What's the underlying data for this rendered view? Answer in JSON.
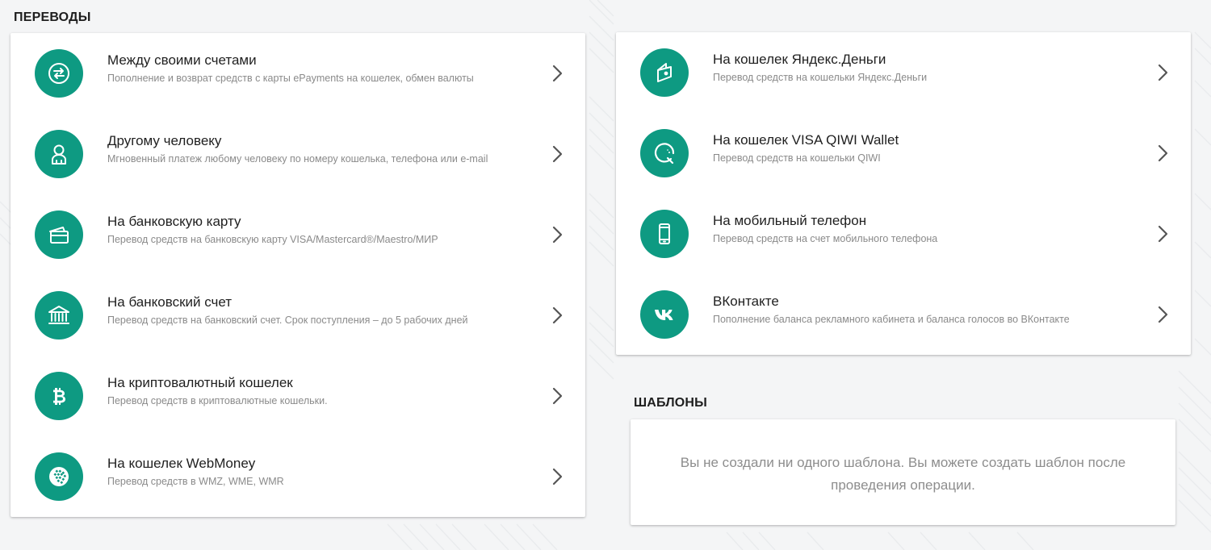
{
  "transfers": {
    "title": "ПЕРЕВОДЫ",
    "left_items": [
      {
        "title": "Между своими счетами",
        "desc": "Пополнение и возврат средств с карты ePayments на кошелек, обмен валюты",
        "icon": "exchange-arrows-icon"
      },
      {
        "title": "Другому человеку",
        "desc": "Мгновенный платеж любому человеку по номеру кошелька, телефона или e-mail",
        "icon": "person-icon"
      },
      {
        "title": "На банковскую карту",
        "desc": "Перевод средств на банковскую карту VISA/Mastercard®/Maestro/МИР",
        "icon": "bank-card-icon"
      },
      {
        "title": "На банковский счет",
        "desc": "Перевод средств на банковский счет. Срок поступления – до 5 рабочих дней",
        "icon": "bank-building-icon"
      },
      {
        "title": "На криптовалютный кошелек",
        "desc": "Перевод средств в криптовалютные кошельки.",
        "icon": "bitcoin-icon"
      },
      {
        "title": "На кошелек WebMoney",
        "desc": "Перевод средств в WMZ, WME, WMR",
        "icon": "webmoney-globe-icon"
      }
    ],
    "right_items": [
      {
        "title": "На кошелек Яндекс.Деньги",
        "desc": "Перевод средств на кошельки Яндекс.Деньги",
        "icon": "yandex-money-wallet-icon"
      },
      {
        "title": "На кошелек VISA QIWI Wallet",
        "desc": "Перевод средств на кошельки QIWI",
        "icon": "qiwi-icon"
      },
      {
        "title": "На мобильный телефон",
        "desc": "Перевод средств на счет мобильного телефона",
        "icon": "mobile-phone-icon"
      },
      {
        "title": "ВКонтакте",
        "desc": "Пополнение баланса рекламного кабинета и баланса голосов во ВКонтакте",
        "icon": "vk-icon"
      }
    ]
  },
  "templates": {
    "title": "ШАБЛОНЫ",
    "empty_text": "Вы не создали ни одного шаблона. Вы можете создать шаблон после проведения операции."
  },
  "colors": {
    "accent": "#0e9a82",
    "background": "#f4f5f6",
    "card": "#ffffff",
    "muted_text": "#8a8a8a"
  }
}
